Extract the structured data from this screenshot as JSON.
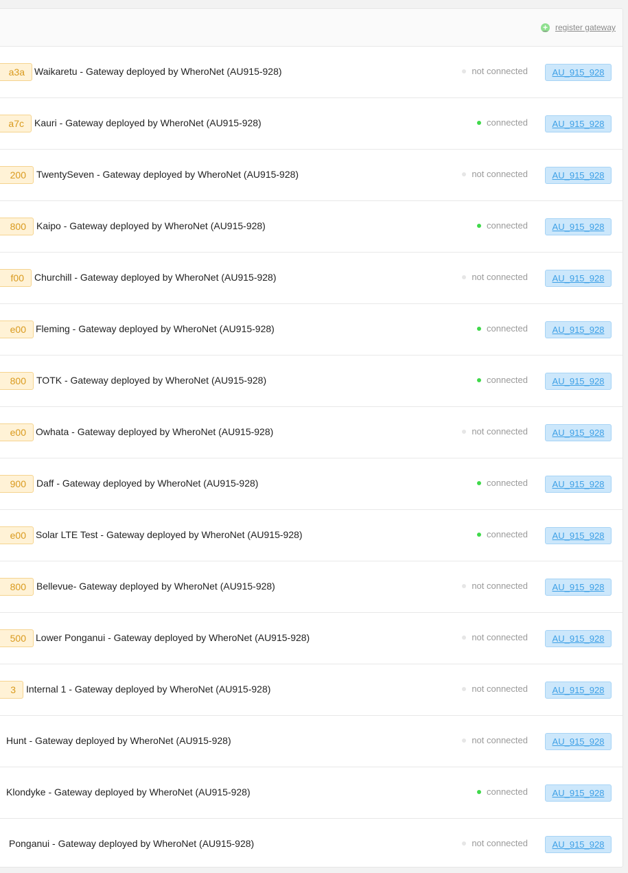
{
  "header": {
    "register_label": "register gateway"
  },
  "colors": {
    "connected_dot": "#3fd94a",
    "not_connected_dot": "#e6e6e6",
    "id_tag_bg": "#fff2d6",
    "id_tag_text": "#d99a1e",
    "band_tag_bg": "#cce7fb",
    "band_tag_text": "#3ea0e6"
  },
  "icons": {
    "register": "plus-circle-icon",
    "status": "status-dot-icon"
  },
  "gateways": [
    {
      "id_suffix": "a3a",
      "name": "Waikaretu - Gateway deployed by WheroNet (AU915-928)",
      "status": "not connected",
      "connected": false,
      "band": "AU_915_928"
    },
    {
      "id_suffix": "a7c",
      "name": "Kauri - Gateway deployed by WheroNet (AU915-928)",
      "status": "connected",
      "connected": true,
      "band": "AU_915_928"
    },
    {
      "id_suffix": "200",
      "name": "TwentySeven - Gateway deployed by WheroNet (AU915-928)",
      "status": "not connected",
      "connected": false,
      "band": "AU_915_928"
    },
    {
      "id_suffix": "800",
      "name": "Kaipo - Gateway deployed by WheroNet (AU915-928)",
      "status": "connected",
      "connected": true,
      "band": "AU_915_928"
    },
    {
      "id_suffix": "f00",
      "name": "Churchill - Gateway deployed by WheroNet (AU915-928)",
      "status": "not connected",
      "connected": false,
      "band": "AU_915_928"
    },
    {
      "id_suffix": "e00",
      "name": "Fleming - Gateway deployed by WheroNet (AU915-928)",
      "status": "connected",
      "connected": true,
      "band": "AU_915_928"
    },
    {
      "id_suffix": "800",
      "name": "TOTK - Gateway deployed by WheroNet (AU915-928)",
      "status": "connected",
      "connected": true,
      "band": "AU_915_928"
    },
    {
      "id_suffix": "e00",
      "name": "Owhata - Gateway deployed by WheroNet (AU915-928)",
      "status": "not connected",
      "connected": false,
      "band": "AU_915_928"
    },
    {
      "id_suffix": "900",
      "name": "Daff - Gateway deployed by WheroNet (AU915-928)",
      "status": "connected",
      "connected": true,
      "band": "AU_915_928"
    },
    {
      "id_suffix": "e00",
      "name": "Solar LTE Test - Gateway deployed by WheroNet (AU915-928)",
      "status": "connected",
      "connected": true,
      "band": "AU_915_928"
    },
    {
      "id_suffix": "800",
      "name": "Bellevue- Gateway deployed by WheroNet (AU915-928)",
      "status": "not connected",
      "connected": false,
      "band": "AU_915_928"
    },
    {
      "id_suffix": "500",
      "name": "Lower Ponganui - Gateway deployed by WheroNet (AU915-928)",
      "status": "not connected",
      "connected": false,
      "band": "AU_915_928"
    },
    {
      "id_suffix": "3",
      "name": "Internal 1 - Gateway deployed by WheroNet (AU915-928)",
      "status": "not connected",
      "connected": false,
      "band": "AU_915_928"
    },
    {
      "id_suffix": "",
      "name": "Hunt - Gateway deployed by WheroNet (AU915-928)",
      "status": "not connected",
      "connected": false,
      "band": "AU_915_928"
    },
    {
      "id_suffix": "",
      "name": "Klondyke - Gateway deployed by WheroNet (AU915-928)",
      "status": "connected",
      "connected": true,
      "band": "AU_915_928"
    },
    {
      "id_suffix": "",
      "name": "Ponganui - Gateway deployed by WheroNet (AU915-928)",
      "status": "not connected",
      "connected": false,
      "band": "AU_915_928"
    }
  ]
}
